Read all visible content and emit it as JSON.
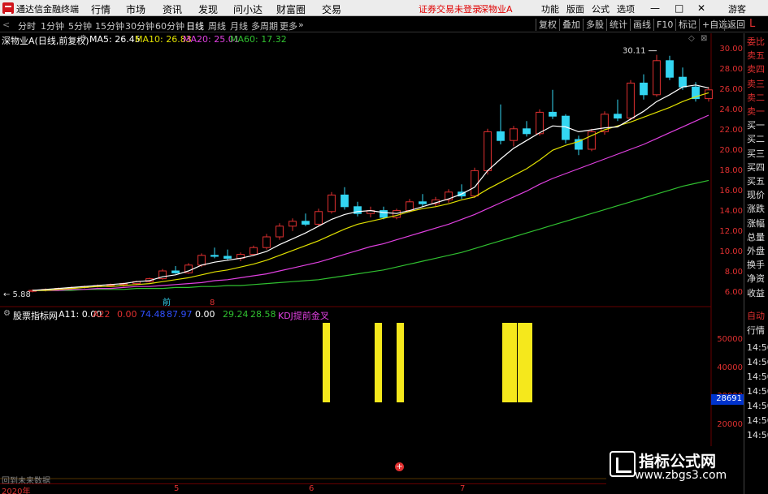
{
  "titlebar": {
    "app_title": "通达信金融终端",
    "menus": [
      "行情",
      "市场",
      "资讯",
      "发现",
      "问小达",
      "财富圈",
      "交易"
    ],
    "login_msg": "证券交易未登录",
    "stock_msg": "深物业A",
    "right_btns": [
      "功能",
      "版面",
      "公式",
      "选项"
    ],
    "guest": "游客"
  },
  "toolbar": {
    "periods": [
      "分时",
      "1分钟",
      "5分钟",
      "15分钟",
      "30分钟",
      "60分钟",
      "日线",
      "周线",
      "月线",
      "多周期",
      "更多"
    ],
    "active": "日线",
    "right": [
      "复权",
      "叠加",
      "多股",
      "统计",
      "画线",
      "F10",
      "标记",
      "+自选",
      "返回"
    ]
  },
  "main_info": {
    "name": "深物业A(日线,前复权)",
    "ma5": "MA5: 26.45",
    "ma10": "MA10: 26.83",
    "ma20": "MA20: 25.01",
    "ma60": "MA60: 17.32",
    "colors": {
      "ma5": "#ffffff",
      "ma10": "#e0e000",
      "ma20": "#e040e0",
      "ma60": "#30c030",
      "up": "#e03030",
      "down": "#33d6f2"
    }
  },
  "main_axis": {
    "labels": [
      "30.00",
      "28.00",
      "26.00",
      "24.00",
      "22.00",
      "20.00",
      "18.00",
      "16.00",
      "14.00",
      "12.00",
      "10.00",
      "8.00",
      "6.00"
    ]
  },
  "annotations": {
    "high": "30.11",
    "low": "5.88",
    "small1": "前",
    "small2": "8"
  },
  "right_panel": {
    "items": [
      "委比",
      "卖五",
      "卖四",
      "卖三",
      "卖二",
      "卖一",
      "买一",
      "买二",
      "买三",
      "买四",
      "买五",
      "现价",
      "涨跌",
      "涨幅",
      "总量",
      "外盘",
      "换手",
      "净资",
      "收益",
      "自动",
      "行情",
      "14:50",
      "14:50",
      "14:50",
      "14:50",
      "14:50",
      "14:50",
      "14:50"
    ]
  },
  "indicator": {
    "name": "股票指标网",
    "a11": "A11: 0.00",
    "a22": "A22",
    "a22v": "0.00",
    "v3": "74.48",
    "v4": "87.97",
    "v5": "0.00",
    "v6": "29.24",
    "v7": "28.58",
    "kdj": "KDJ提前金叉",
    "dash": "-",
    "axis": [
      "50000",
      "40000",
      "30000",
      "20000"
    ],
    "highlight": "28691"
  },
  "bottom": {
    "ticker_text": "回到未来数据",
    "years": [
      "2020年",
      "5",
      "6",
      "7"
    ]
  },
  "watermark": {
    "title": "指标公式网",
    "url": "www.zbgs3.com"
  },
  "chart_data": {
    "type": "candlestick",
    "ylim": [
      5,
      31
    ],
    "candles": [
      [
        5.9,
        6.1,
        5.8,
        6.0
      ],
      [
        6.0,
        6.2,
        5.9,
        6.1
      ],
      [
        6.1,
        6.3,
        6.0,
        6.2
      ],
      [
        6.2,
        6.4,
        6.1,
        6.3
      ],
      [
        6.3,
        6.5,
        6.2,
        6.4
      ],
      [
        6.4,
        6.6,
        6.3,
        6.5
      ],
      [
        6.5,
        6.7,
        6.4,
        6.6
      ],
      [
        6.6,
        6.8,
        6.4,
        6.7
      ],
      [
        6.7,
        7.0,
        6.6,
        6.9
      ],
      [
        6.9,
        7.3,
        6.8,
        7.2
      ],
      [
        7.2,
        8.2,
        7.1,
        8.0
      ],
      [
        8.0,
        8.5,
        7.7,
        7.8
      ],
      [
        7.8,
        8.8,
        7.7,
        8.6
      ],
      [
        8.6,
        9.8,
        8.4,
        9.6
      ],
      [
        9.6,
        10.4,
        9.3,
        9.5
      ],
      [
        9.5,
        10.2,
        9.1,
        9.3
      ],
      [
        9.3,
        9.9,
        9.0,
        9.7
      ],
      [
        9.7,
        10.6,
        9.6,
        10.4
      ],
      [
        10.4,
        11.8,
        10.2,
        11.5
      ],
      [
        11.5,
        12.9,
        11.2,
        12.6
      ],
      [
        12.6,
        13.4,
        12.1,
        13.1
      ],
      [
        13.1,
        13.9,
        12.6,
        12.8
      ],
      [
        12.8,
        14.4,
        12.6,
        14.1
      ],
      [
        14.1,
        16.1,
        13.9,
        15.8
      ],
      [
        15.8,
        16.6,
        14.3,
        14.6
      ],
      [
        14.6,
        15.1,
        13.6,
        13.9
      ],
      [
        13.9,
        14.6,
        13.5,
        14.2
      ],
      [
        14.2,
        14.6,
        13.3,
        13.5
      ],
      [
        13.5,
        14.4,
        13.3,
        14.2
      ],
      [
        14.2,
        15.4,
        14.0,
        15.1
      ],
      [
        15.1,
        15.9,
        14.6,
        14.9
      ],
      [
        14.9,
        15.6,
        14.6,
        15.3
      ],
      [
        15.3,
        16.4,
        15.0,
        16.1
      ],
      [
        16.1,
        16.9,
        15.4,
        15.7
      ],
      [
        15.7,
        18.6,
        15.5,
        18.3
      ],
      [
        18.3,
        22.6,
        17.9,
        22.3
      ],
      [
        22.3,
        25.1,
        21.0,
        21.4
      ],
      [
        21.4,
        22.9,
        20.8,
        22.6
      ],
      [
        22.6,
        23.4,
        21.8,
        22.1
      ],
      [
        22.1,
        24.6,
        21.9,
        24.3
      ],
      [
        24.3,
        26.6,
        23.6,
        23.9
      ],
      [
        23.9,
        24.1,
        21.1,
        21.5
      ],
      [
        21.5,
        21.9,
        19.9,
        20.5
      ],
      [
        20.5,
        22.6,
        20.3,
        22.3
      ],
      [
        22.3,
        24.4,
        22.0,
        24.1
      ],
      [
        24.1,
        25.6,
        23.4,
        23.7
      ],
      [
        23.7,
        27.6,
        23.5,
        27.3
      ],
      [
        27.3,
        28.2,
        25.6,
        26.1
      ],
      [
        26.1,
        30.2,
        25.9,
        29.6
      ],
      [
        29.6,
        30.1,
        27.6,
        27.9
      ],
      [
        27.9,
        28.9,
        26.6,
        26.9
      ],
      [
        26.9,
        27.4,
        25.4,
        25.7
      ],
      [
        25.7,
        26.9,
        25.4,
        26.6
      ]
    ],
    "ma5": [
      6.0,
      6.1,
      6.2,
      6.3,
      6.4,
      6.5,
      6.6,
      6.7,
      6.9,
      7.0,
      7.4,
      7.6,
      8.0,
      8.6,
      8.9,
      9.1,
      9.3,
      9.6,
      10.0,
      10.7,
      11.3,
      11.9,
      12.6,
      13.3,
      13.8,
      14.1,
      14.2,
      14.0,
      13.9,
      14.2,
      14.6,
      15.0,
      15.4,
      15.9,
      16.6,
      18.3,
      19.5,
      20.6,
      21.4,
      22.2,
      22.9,
      22.8,
      22.3,
      22.5,
      22.7,
      22.8,
      23.6,
      24.4,
      25.4,
      26.1,
      26.9,
      27.1,
      26.8
    ],
    "ma10": [
      6.0,
      6.0,
      6.1,
      6.2,
      6.3,
      6.4,
      6.4,
      6.5,
      6.6,
      6.7,
      6.9,
      7.1,
      7.3,
      7.6,
      7.9,
      8.1,
      8.4,
      8.7,
      9.1,
      9.6,
      10.1,
      10.6,
      11.1,
      11.7,
      12.3,
      12.8,
      13.1,
      13.4,
      13.7,
      14.1,
      14.4,
      14.6,
      14.9,
      15.3,
      15.6,
      16.4,
      17.1,
      17.8,
      18.5,
      19.4,
      20.4,
      20.9,
      21.3,
      21.9,
      22.5,
      22.9,
      23.3,
      23.8,
      24.3,
      24.8,
      25.4,
      25.9,
      26.3
    ],
    "ma20": [
      6.0,
      6.0,
      6.0,
      6.1,
      6.1,
      6.2,
      6.2,
      6.3,
      6.4,
      6.4,
      6.5,
      6.6,
      6.7,
      6.8,
      7.0,
      7.1,
      7.3,
      7.5,
      7.7,
      8.0,
      8.3,
      8.6,
      8.9,
      9.3,
      9.7,
      10.1,
      10.5,
      10.8,
      11.2,
      11.6,
      12.0,
      12.4,
      12.8,
      13.3,
      13.8,
      14.4,
      15.0,
      15.6,
      16.2,
      16.9,
      17.5,
      18.0,
      18.5,
      19.0,
      19.5,
      20.0,
      20.5,
      21.0,
      21.6,
      22.2,
      22.8,
      23.4,
      24.0
    ],
    "ma60": [
      6.0,
      6.0,
      6.0,
      6.0,
      6.1,
      6.1,
      6.1,
      6.1,
      6.2,
      6.2,
      6.2,
      6.3,
      6.3,
      6.4,
      6.4,
      6.5,
      6.5,
      6.6,
      6.7,
      6.8,
      6.9,
      7.0,
      7.1,
      7.3,
      7.5,
      7.7,
      7.9,
      8.1,
      8.4,
      8.7,
      9.0,
      9.3,
      9.6,
      9.9,
      10.3,
      10.7,
      11.1,
      11.5,
      11.9,
      12.3,
      12.7,
      13.1,
      13.5,
      13.9,
      14.3,
      14.7,
      15.1,
      15.5,
      15.9,
      16.3,
      16.7,
      17.0,
      17.3
    ],
    "signals": [
      {
        "index": 14,
        "width": 1
      },
      {
        "index": 17,
        "width": 1
      },
      {
        "index": 18,
        "width": 1
      },
      {
        "index": 30,
        "width": 2
      },
      {
        "index": 31,
        "width": 2
      }
    ]
  }
}
